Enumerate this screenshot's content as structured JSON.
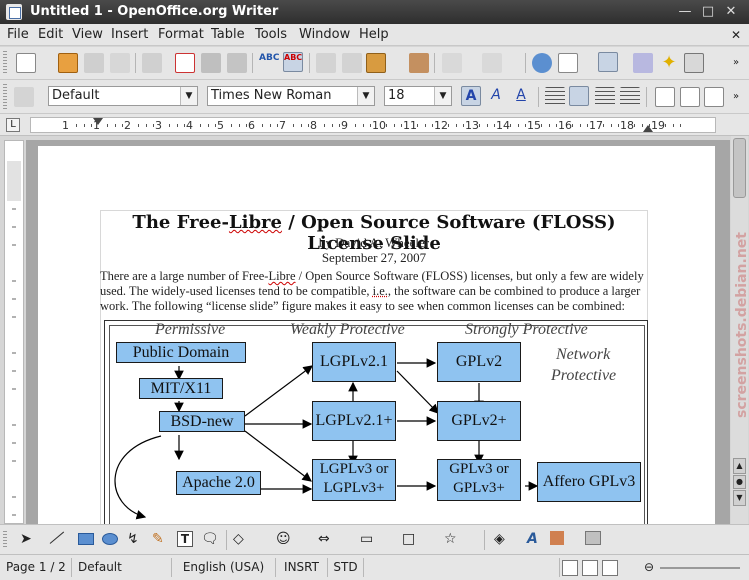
{
  "window": {
    "title": "Untitled 1 - OpenOffice.org Writer"
  },
  "menu": [
    "File",
    "Edit",
    "View",
    "Insert",
    "Format",
    "Table",
    "Tools",
    "Window",
    "Help"
  ],
  "formatting": {
    "style": "Default",
    "font": "Times New Roman",
    "size": "18"
  },
  "ruler": {
    "numbers": [
      "1",
      "1",
      "2",
      "3",
      "4",
      "5",
      "6",
      "7",
      "8",
      "9",
      "10",
      "11",
      "12",
      "13",
      "14",
      "15",
      "16",
      "17",
      "18",
      "19"
    ]
  },
  "document": {
    "title_part1": "The Free-",
    "title_libre": "Libre",
    "title_part2": " / Open Source Software (FLOSS) License Slide",
    "author": "by David A. Wheeler",
    "date": "September 27, 2007",
    "para_line1_a": "There are a large number of Free-",
    "para_line1_libre": "Libre",
    "para_line1_b": " / Open Source Software (FLOSS) licenses, but only a few are widely",
    "para_line2_a": "used.  The widely-used licenses tend to be compatible, ",
    "para_line2_ie": "i.e.",
    "para_line2_b": ", the software can be combined to produce a larger",
    "para_line3": "work.  The following “license slide” figure makes it easy to see when common licenses can be combined:"
  },
  "diagram": {
    "categories": {
      "permissive": "Permissive",
      "weakly": "Weakly Protective",
      "strongly": "Strongly Protective",
      "network_1": "Network",
      "network_2": "Protective"
    },
    "nodes": {
      "public_domain": "Public Domain",
      "mit": "MIT/X11",
      "bsd": "BSD-new",
      "apache": "Apache 2.0",
      "lgpl21": "LGPLv2.1",
      "lgpl21plus": "LGPLv2.1+",
      "lgpl3_1": "LGPLv3  or",
      "lgpl3_2": "LGPLv3+",
      "gpl2": "GPLv2",
      "gpl2plus": "GPLv2+",
      "gpl3_1": "GPLv3  or",
      "gpl3_2": "GPLv3+",
      "affero": "Affero GPLv3"
    }
  },
  "watermark": "screenshots.debian.net",
  "status": {
    "page": "Page 1 / 2",
    "style": "Default",
    "language": "English (USA)",
    "insert": "INSRT",
    "selection": "STD"
  },
  "colors": {
    "node_fill": "#8fc3f0",
    "titlebar": "#3a3a3a"
  }
}
